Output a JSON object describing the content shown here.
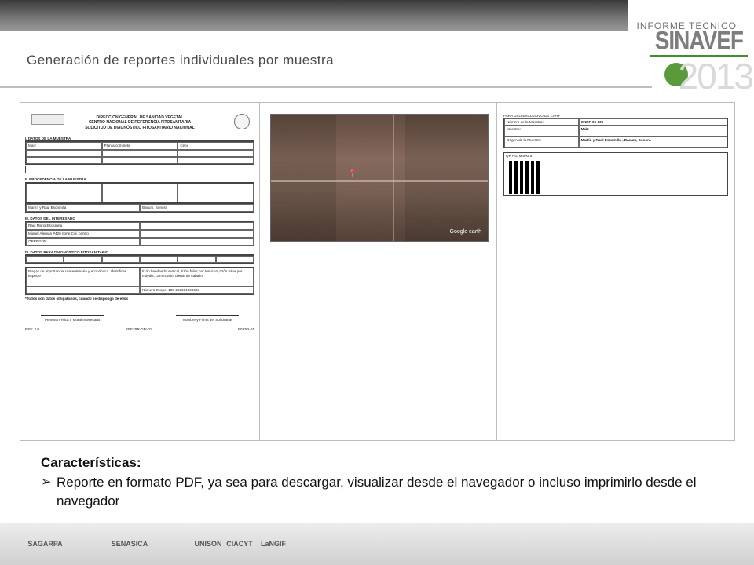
{
  "header": {
    "title": "Generación de reportes individuales por muestra",
    "brand_top": "INFORME TECNICO",
    "brand_name": "SINAVEF",
    "brand_year": "2013"
  },
  "report": {
    "heading_lines": [
      "DIRECCIÓN GENERAL DE SANIDAD VEGETAL",
      "CENTRO NACIONAL DE REFERENCIA FITOSANITARIA",
      "SOLICITUD DE DIAGNÓSTICO FITOSANITARIO NACIONAL"
    ],
    "section1": "I. DATOS DE LA MUESTRA",
    "host": "Maíz",
    "plant_part": "Planta completa",
    "variety": "Cebu",
    "section2": "II. PROCEDENCIA DE LA MUESTRA",
    "locality": "Martín y Raúl Escamilla",
    "municipality": "Bácum, Sonora",
    "section3": "III. DATOS DEL INTERESADO",
    "name": "Raul Mario Escamilla",
    "address": "Miguel Alemán #420 norte Col. centro",
    "colonia": "OBREGON",
    "section4": "IV. DATOS PARA DIAGNÓSTICO FITOSANITARIO",
    "pest": "Plagas de importancia cuarentenaria y económica. Identificar especie",
    "observations": "tizón bandeado vertical, tizón foliar por turcicum,tizón foliar por maydis, carnezuelo, diente de caballo.",
    "scope_number": "Número Scope: 186-250314890603",
    "note": "*Todos son datos obligatorios, cuando se disponga de ellos",
    "sig1": "Persona Física ó Moral Interesada",
    "sig2": "Nombre y Firma del Solicitante",
    "rev": "REV. 2.0",
    "ref": "REF: PR-DFI-01",
    "code": "F0-DFI-01"
  },
  "map": {
    "watermark": "Google earth"
  },
  "lab": {
    "heading": "PARA USO EXCLUSIVO DE CNRF",
    "sample_no_label": "Número de la Muestra:",
    "sample_no": "CNRF-00-330",
    "sample_label": "Muestra:",
    "sample": "Maíz",
    "origin_label": "Origen de la Muestra:",
    "origin": "Martín y Raúl Escamilla , Bácum, Sonora",
    "qr_label": "QR No. Muestra"
  },
  "caption": {
    "title": "Características:",
    "bullet": "Reporte en formato PDF, ya sea para descargar, visualizar desde el navegador o incluso imprimirlo desde el navegador"
  },
  "footer": {
    "logos": [
      "SAGARPA",
      "SENASICA",
      "UNISON",
      "CIACYT",
      "LaNGIF"
    ]
  }
}
